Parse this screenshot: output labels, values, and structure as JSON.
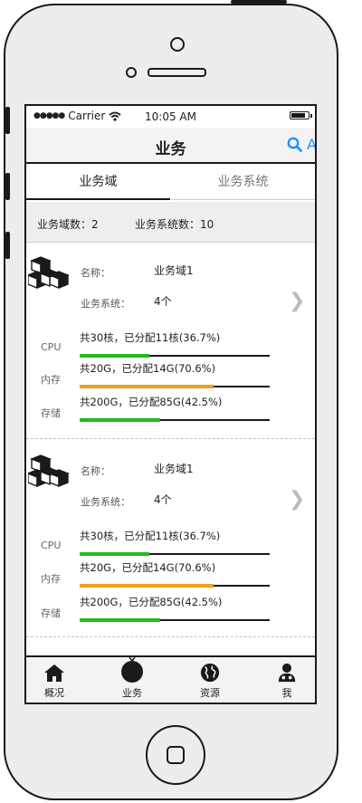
{
  "status": {
    "carrier": "Carrier",
    "time": "10:05 AM"
  },
  "nav": {
    "title": "业务",
    "action": "Action"
  },
  "tabs": [
    {
      "label": "业务域"
    },
    {
      "label": "业务系统"
    }
  ],
  "summary": {
    "domain_count_label": "业务域数：2",
    "system_count_label": "业务系统数：10"
  },
  "cards": [
    {
      "name_label": "名称：",
      "name_value": "业务域1",
      "systems_label": "业务系统：",
      "systems_value": "4个",
      "resources": [
        {
          "label": "CPU",
          "text": "共30核，已分配11核(36.7%)",
          "fraction": 0.367,
          "color": "#22bb22"
        },
        {
          "label": "内存",
          "text": "共20G，已分配14G(70.6%)",
          "fraction": 0.706,
          "color": "#f0a020"
        },
        {
          "label": "存储",
          "text": "共200G，已分配85G(42.5%)",
          "fraction": 0.425,
          "color": "#22bb22"
        }
      ]
    },
    {
      "name_label": "名称：",
      "name_value": "业务域1",
      "systems_label": "业务系统：",
      "systems_value": "4个",
      "resources": [
        {
          "label": "CPU",
          "text": "共30核，已分配11核(36.7%)",
          "fraction": 0.367,
          "color": "#22bb22"
        },
        {
          "label": "内存",
          "text": "共20G，已分配14G(70.6%)",
          "fraction": 0.706,
          "color": "#f0a020"
        },
        {
          "label": "存储",
          "text": "共200G，已分配85G(42.5%)",
          "fraction": 0.425,
          "color": "#22bb22"
        }
      ]
    }
  ],
  "tabbar": [
    {
      "label": "概况",
      "icon": "home-icon"
    },
    {
      "label": "业务",
      "icon": "business-icon"
    },
    {
      "label": "资源",
      "icon": "globe-icon"
    },
    {
      "label": "我",
      "icon": "user-icon"
    }
  ],
  "colors": {
    "accent": "#1e90ff",
    "progress_green": "#22bb22",
    "progress_orange": "#f0a020"
  }
}
